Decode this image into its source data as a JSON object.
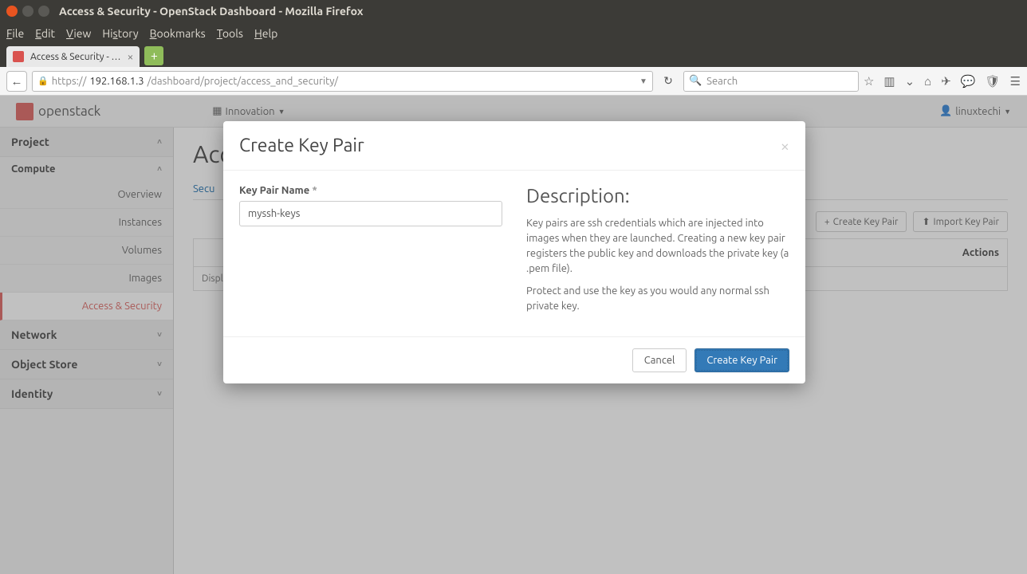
{
  "window": {
    "title": "Access & Security - OpenStack Dashboard - Mozilla Firefox"
  },
  "menubar": {
    "file": "File",
    "edit": "Edit",
    "view": "View",
    "history": "History",
    "bookmarks": "Bookmarks",
    "tools": "Tools",
    "help": "Help"
  },
  "tab": {
    "title": "Access & Security - …"
  },
  "url": {
    "scheme": "https://",
    "host": "192.168.1.3",
    "path": "/dashboard/project/access_and_security/"
  },
  "search": {
    "placeholder": "Search"
  },
  "topbar": {
    "brand": "openstack",
    "project": "Innovation",
    "user": "linuxtechi"
  },
  "sidebar": {
    "project": "Project",
    "compute": "Compute",
    "items": [
      "Overview",
      "Instances",
      "Volumes",
      "Images",
      "Access & Security"
    ],
    "network": "Network",
    "objectstore": "Object Store",
    "identity": "Identity"
  },
  "main": {
    "heading": "Acc",
    "tab_label": "Secu",
    "create_btn": "Create Key Pair",
    "import_btn": "Import Key Pair",
    "col_actions": "Actions",
    "footer": "Displ"
  },
  "modal": {
    "title": "Create Key Pair",
    "field_label": "Key Pair Name",
    "field_req": "*",
    "field_value": "myssh-keys",
    "desc_heading": "Description:",
    "desc_p1": "Key pairs are ssh credentials which are injected into images when they are launched. Creating a new key pair registers the public key and downloads the private key (a .pem file).",
    "desc_p2": "Protect and use the key as you would any normal ssh private key.",
    "cancel": "Cancel",
    "submit": "Create Key Pair"
  }
}
